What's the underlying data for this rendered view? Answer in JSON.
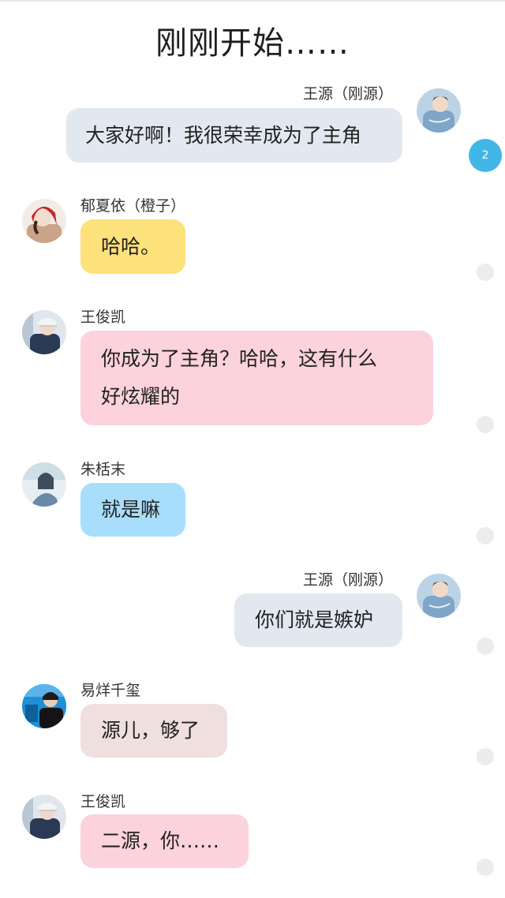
{
  "header": {
    "title": "刚刚开始……"
  },
  "messages": [
    {
      "sender": "王源（刚源）",
      "text": "大家好啊！我很荣幸成为了主角",
      "side": "right",
      "bubble_color": "#e2e8f0",
      "avatar": "wang-yuan-avatar"
    },
    {
      "sender": "郁夏依（橙子）",
      "text": "哈哈。",
      "side": "left",
      "bubble_color": "#fde17a",
      "avatar": "yu-xiayi-avatar"
    },
    {
      "sender": "王俊凯",
      "text_line1": "你成为了主角？哈哈，这有什么",
      "text_line2": "好炫耀的",
      "side": "left",
      "bubble_color": "#fcd2dc",
      "avatar": "wang-junkai-avatar"
    },
    {
      "sender": "朱栝末",
      "text": "就是嘛",
      "side": "left",
      "bubble_color": "#a8defb",
      "avatar": "zhu-kuomo-avatar"
    },
    {
      "sender": "王源（刚源）",
      "text": "你们就是嫉妒",
      "side": "right",
      "bubble_color": "#e2e8f0",
      "avatar": "wang-yuan-avatar"
    },
    {
      "sender": "易烊千玺",
      "text": "源儿，够了",
      "side": "left",
      "bubble_color": "#f0dfdf",
      "avatar": "yi-yangqianxi-avatar"
    },
    {
      "sender": "王俊凯",
      "text": "二源，你……",
      "side": "left",
      "bubble_color": "#fcd2dc",
      "avatar": "wang-junkai-avatar"
    }
  ],
  "badge": {
    "count": "2",
    "color": "#41b7e6"
  }
}
